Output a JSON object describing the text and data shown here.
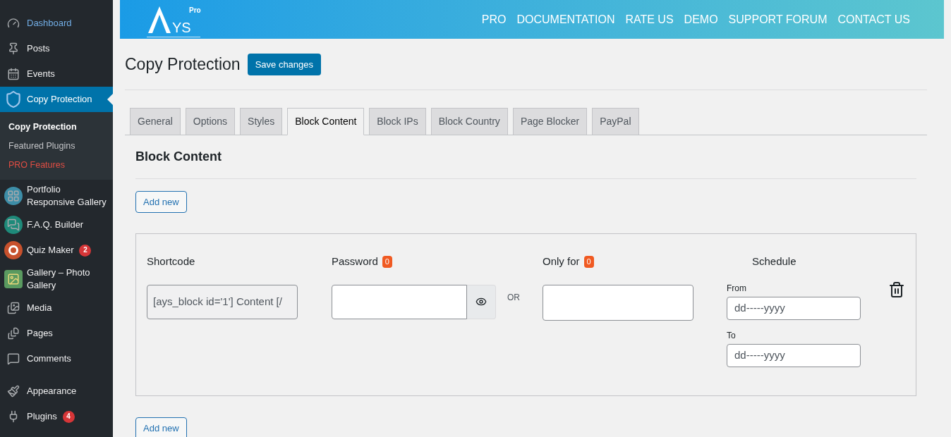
{
  "sidebar": {
    "groups": [
      {
        "items": [
          {
            "label": "Dashboard",
            "selected": false,
            "highlight": true
          },
          {
            "label": "Posts",
            "selected": false,
            "highlight": false
          },
          {
            "label": "Events",
            "selected": false,
            "highlight": false
          },
          {
            "label": "Copy Protection",
            "selected": true,
            "highlight": false,
            "submenu": [
              {
                "label": "Copy Protection",
                "selected": true,
                "kind": "normal"
              },
              {
                "label": "Featured Plugins",
                "selected": false,
                "kind": "normal"
              },
              {
                "label": "PRO Features",
                "selected": false,
                "kind": "pro"
              }
            ]
          },
          {
            "label": "Portfolio Responsive Gallery",
            "selected": false,
            "highlight": false
          },
          {
            "label": "F.A.Q. Builder",
            "selected": false,
            "highlight": false
          },
          {
            "label": "Quiz Maker",
            "selected": false,
            "highlight": false,
            "badge": "2"
          },
          {
            "label": "Gallery – Photo Gallery",
            "selected": false,
            "highlight": false
          },
          {
            "label": "Media",
            "selected": false,
            "highlight": false
          },
          {
            "label": "Pages",
            "selected": false,
            "highlight": false
          },
          {
            "label": "Comments",
            "selected": false,
            "highlight": false
          }
        ]
      },
      {
        "items": [
          {
            "label": "Appearance",
            "selected": false,
            "highlight": false
          },
          {
            "label": "Plugins",
            "selected": false,
            "highlight": false,
            "badge": "4"
          }
        ]
      }
    ]
  },
  "banner": {
    "logo_text": "YS",
    "logo_sup": "Pro",
    "links": [
      "PRO",
      "DOCUMENTATION",
      "RATE US",
      "DEMO",
      "SUPPORT FORUM",
      "CONTACT US"
    ]
  },
  "page_title": "Copy Protection",
  "save_button": "Save changes",
  "tabs": [
    {
      "label": "General",
      "selected": false
    },
    {
      "label": "Options",
      "selected": false
    },
    {
      "label": "Styles",
      "selected": false
    },
    {
      "label": "Block Content",
      "selected": true
    },
    {
      "label": "Block IPs",
      "selected": false
    },
    {
      "label": "Block Country",
      "selected": false
    },
    {
      "label": "Page Blocker",
      "selected": false
    },
    {
      "label": "PayPal",
      "selected": false
    }
  ],
  "section_title": "Block Content",
  "add_new": "Add new",
  "block": {
    "shortcode_label": "Shortcode",
    "shortcode_value": "[ays_block id='1'] Content [/",
    "password_label": "Password",
    "password_count": "0",
    "or": "OR",
    "only_for_label": "Only for",
    "only_for_count": "0",
    "schedule_label": "Schedule",
    "from_label": "From",
    "from_value": "dd-----yyyy",
    "to_label": "To",
    "to_value": "dd-----yyyy"
  },
  "add_new_bottom": "Add new"
}
